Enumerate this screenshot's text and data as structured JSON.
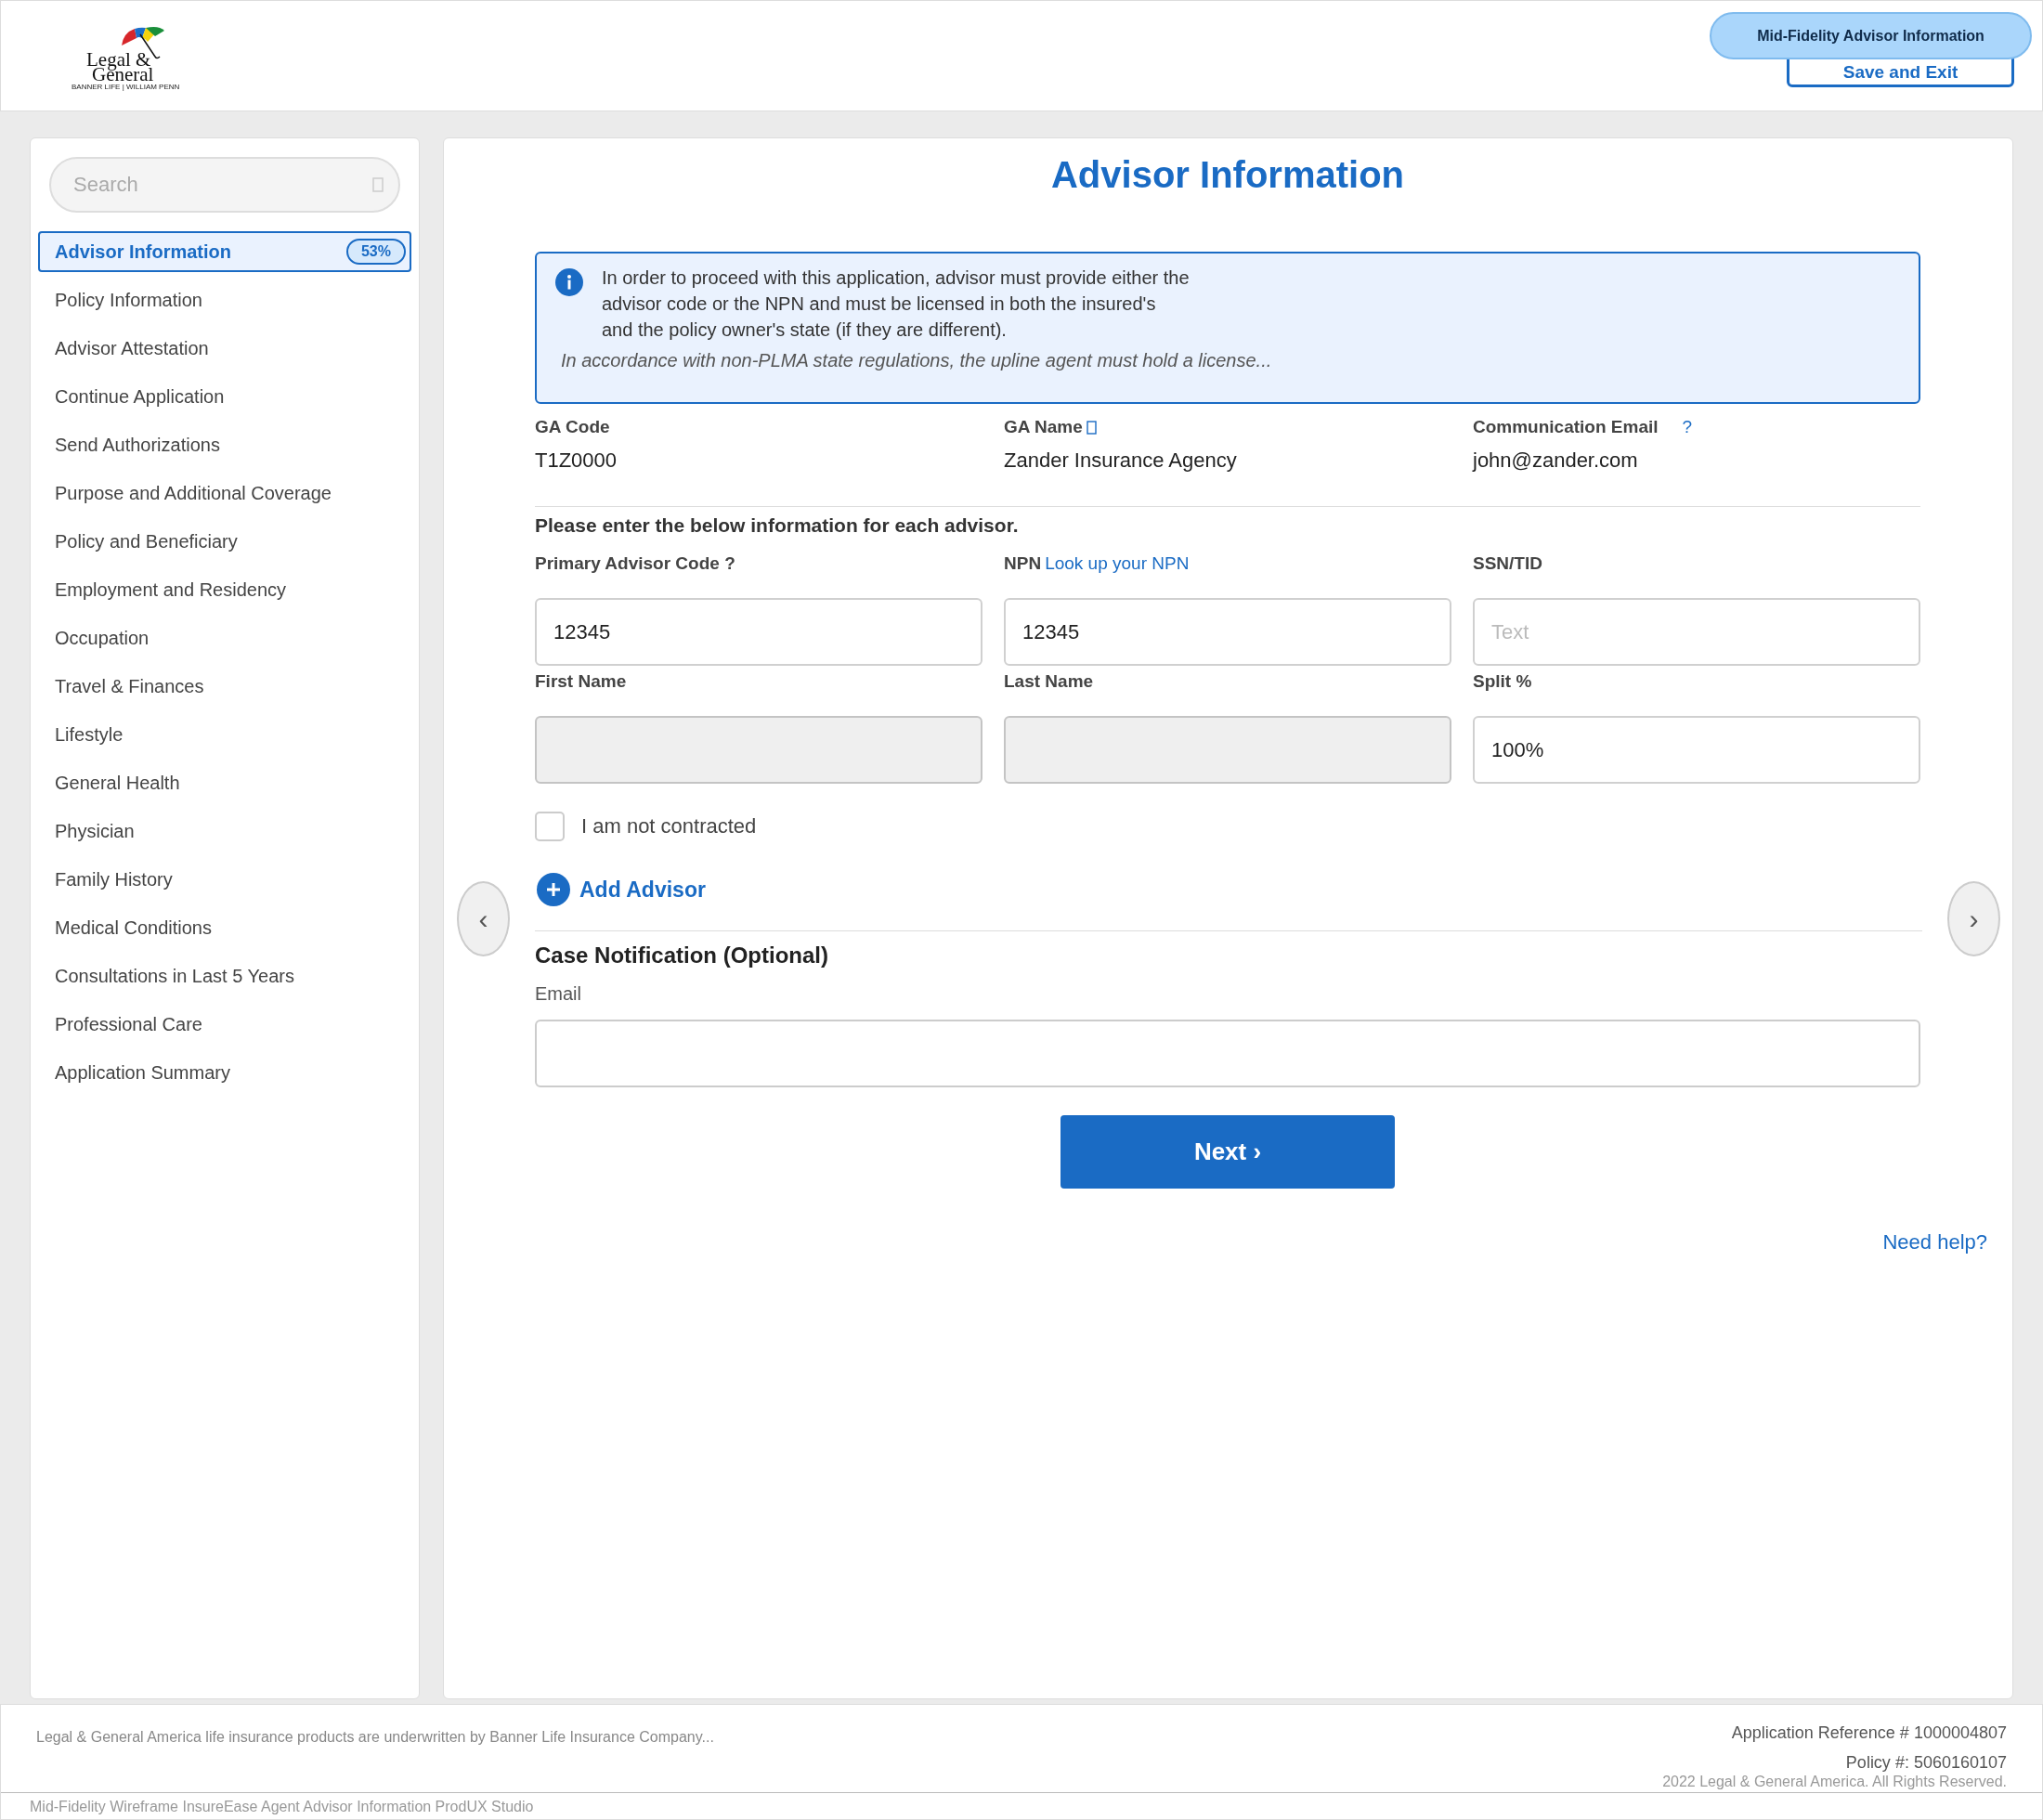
{
  "header": {
    "logo": {
      "line_1": "Legal &",
      "line_2": "General",
      "tagline": "BANNER LIFE | WILLIAM PENN"
    },
    "save_button": "Save and Exit",
    "wireframe_badge": "Mid-Fidelity Advisor Information"
  },
  "sidebar": {
    "search": {
      "placeholder": "Search"
    },
    "items": [
      {
        "label": "Advisor Information",
        "selected": true,
        "progress": "53%"
      },
      {
        "label": "Policy Information",
        "selected": false
      },
      {
        "label": "Advisor Attestation",
        "selected": false
      },
      {
        "label": "Continue Application",
        "selected": false
      },
      {
        "label": "Send Authorizations",
        "selected": false
      },
      {
        "label": "Purpose and Additional Coverage",
        "selected": false
      },
      {
        "label": "Policy and Beneficiary",
        "selected": false
      },
      {
        "label": "Employment and Residency",
        "selected": false
      },
      {
        "label": "Occupation",
        "selected": false
      },
      {
        "label": "Travel & Finances",
        "selected": false
      },
      {
        "label": "Lifestyle",
        "selected": false
      },
      {
        "label": "General Health",
        "selected": false
      },
      {
        "label": "Physician",
        "selected": false
      },
      {
        "label": "Family History",
        "selected": false
      },
      {
        "label": "Medical Conditions",
        "selected": false
      },
      {
        "label": "Consultations in Last 5 Years",
        "selected": false
      },
      {
        "label": "Professional Care",
        "selected": false
      },
      {
        "label": "Application Summary",
        "selected": false
      }
    ]
  },
  "main": {
    "title": "Advisor Information",
    "info": {
      "text": "In order to proceed with this application, advisor must provide either the\nadvisor code or the NPN and must be licensed in both the insured's\nand the policy owner's state (if they are different).",
      "note": "In accordance with non-PLMA state regulations, the upline agent must hold a license..."
    },
    "ga_fields": [
      {
        "label": "GA Code",
        "value": "T1Z0000"
      },
      {
        "label": "GA Name",
        "value": "Zander Insurance Agency"
      },
      {
        "label": "Communication Email",
        "help": "?",
        "value": "john@zander.com"
      }
    ],
    "advisor_prompt": "Please enter the below information for each advisor.",
    "advisor_fields": [
      {
        "label": "Primary Advisor Code ?",
        "value": "12345",
        "disabled": false
      },
      {
        "label": "NPN",
        "link": "Look up your NPN",
        "value": "12345",
        "disabled": false
      },
      {
        "label": "SSN/TID",
        "placeholder": "Text",
        "disabled": false
      },
      {
        "label": "First Name",
        "disabled": true
      },
      {
        "label": "Last Name",
        "disabled": true
      },
      {
        "label": "Split %",
        "value": "100%",
        "disabled": false
      }
    ],
    "not_contracted": {
      "label": "I am not contracted",
      "checked": false
    },
    "add_advisor": "Add Advisor",
    "prev_button": "‹",
    "next_arrow": "›",
    "case_notification": {
      "title": "Case Notification (Optional)",
      "email_label": "Email"
    },
    "next_button": "Next ›",
    "help_link": "Need help?"
  },
  "footer": {
    "disclaimer": "Legal & General America life insurance products are underwritten by Banner Life Insurance Company...",
    "application_reference": "Application Reference # 1000004807",
    "policy_number": "Policy #: 5060160107",
    "copyright": "2022 Legal & General America. All Rights Reserved.",
    "wireframe_caption": "Mid-Fidelity Wireframe InsureEase Agent Advisor Information ProdUX Studio"
  }
}
